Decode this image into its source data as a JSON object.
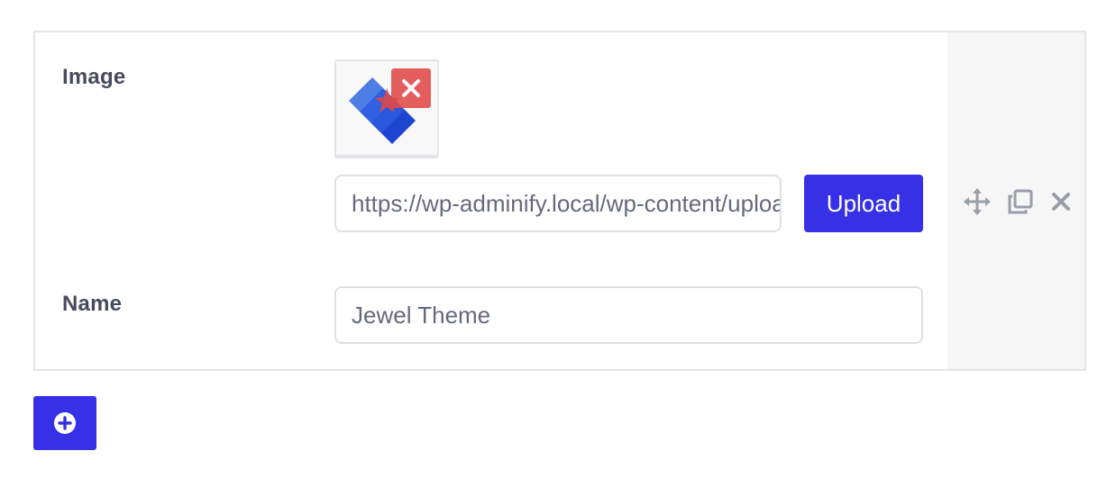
{
  "repeater": {
    "item": {
      "image_field": {
        "label": "Image",
        "url_value": "https://wp-adminify.local/wp-content/uploads/jewel-theme-logo.png",
        "upload_label": "Upload",
        "preview_icon": "jewel-theme-logo",
        "remove_icon": "close-icon"
      },
      "name_field": {
        "label": "Name",
        "value": "Jewel Theme"
      },
      "actions": {
        "move_icon": "move-icon",
        "clone_icon": "clone-icon",
        "remove_icon": "close-icon"
      }
    },
    "add_icon": "plus-circle-icon"
  },
  "colors": {
    "accent": "#3630e6",
    "remove_red": "#e04848",
    "logo_blue_dark": "#1d45d0",
    "logo_blue_light": "#4f7de6",
    "label_text": "#454a5e",
    "input_text": "#646a7e",
    "action_icon": "#9a9ea9"
  }
}
